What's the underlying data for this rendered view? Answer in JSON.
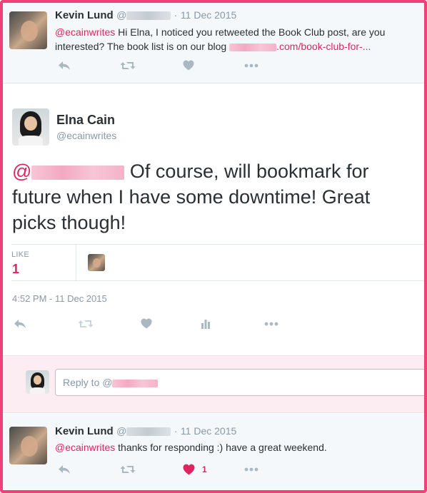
{
  "top_tweet": {
    "name": "Kevin Lund",
    "handle_prefix": "@",
    "separator": "·",
    "date": "11 Dec 2015",
    "mention": "@ecainwrites",
    "text": " Hi Elna, I noticed you retweeted the Book Club post, are you interested? The book list is on our blog ",
    "link": ".com/book-club-for-...",
    "actions": [
      "reply-icon",
      "retweet-icon",
      "like-icon",
      "more-icon"
    ]
  },
  "main_tweet": {
    "name": "Elna Cain",
    "handle": "@ecainwrites",
    "mention_prefix": "@",
    "text": " Of course, will bookmark for future when I have some downtime! Great picks though!",
    "likes_label": "LIKE",
    "likes_count": "1",
    "timestamp": "4:52 PM - 11 Dec 2015",
    "actions": [
      "reply-icon",
      "retweet-icon",
      "like-icon",
      "analytics-icon",
      "more-icon"
    ]
  },
  "reply": {
    "placeholder_prefix": "Reply to @"
  },
  "bottom_tweet": {
    "name": "Kevin Lund",
    "handle_prefix": "@",
    "separator": "·",
    "date": "11 Dec 2015",
    "mention": "@ecainwrites",
    "text": " thanks for responding :) have a great weekend.",
    "like_count": "1",
    "actions": [
      "reply-icon",
      "retweet-icon",
      "liked-icon",
      "more-icon"
    ]
  },
  "colors": {
    "frame": "#f0407a",
    "accent": "#e0245e",
    "icon_grey": "#aab8c2",
    "secondary_text": "#8899a6"
  }
}
